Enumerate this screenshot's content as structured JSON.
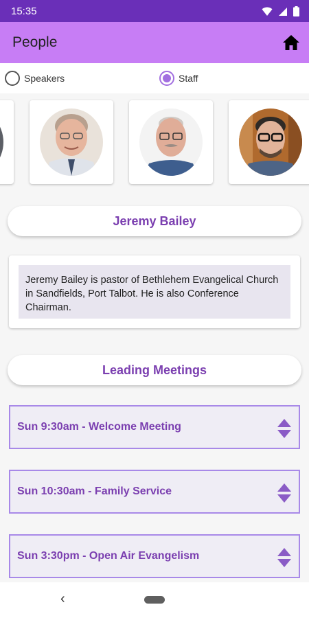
{
  "status_bar": {
    "time": "15:35",
    "icons": [
      "wifi-icon",
      "signal-icon",
      "battery-icon"
    ]
  },
  "app_bar": {
    "title": "People",
    "home_icon": "home-icon"
  },
  "filter": {
    "options": [
      {
        "label": "Speakers",
        "selected": false
      },
      {
        "label": "Staff",
        "selected": true
      }
    ]
  },
  "people": [
    {
      "name": "person-1"
    },
    {
      "name": "person-2"
    },
    {
      "name": "person-3"
    },
    {
      "name": "person-4"
    }
  ],
  "selected_person": {
    "name": "Jeremy Bailey",
    "bio": "Jeremy Bailey is pastor of Bethlehem Evangelical Church in Sandfields, Port Talbot. He is also Conference Chairman."
  },
  "meetings_section": {
    "title": "Leading Meetings"
  },
  "meetings": [
    {
      "label": "Sun 9:30am - Welcome Meeting"
    },
    {
      "label": "Sun 10:30am - Family Service"
    },
    {
      "label": "Sun 3:30pm - Open Air Evangelism"
    }
  ],
  "nav_bar": {
    "back_glyph": "‹"
  },
  "colors": {
    "status_bar": "#6a2fb8",
    "app_bar": "#c77df5",
    "accent": "#7b3fb0",
    "radio_selected": "#a26fe0",
    "meeting_border": "#a889e8"
  }
}
